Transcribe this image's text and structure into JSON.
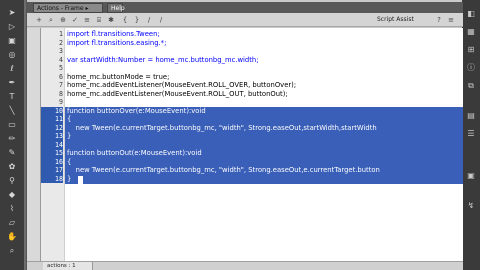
{
  "tabs": {
    "actions_label": "Actions - Frame ▸",
    "help_label": "Help"
  },
  "toolbar": {
    "script_assist_label": "Script Assist",
    "icons": [
      "add-icon",
      "find-icon",
      "target-icon",
      "check-syntax-icon",
      "auto-format-icon",
      "code-hint-icon",
      "debug-icon",
      "collapse-icon",
      "expand-icon",
      "comment-icon",
      "uncomment-icon",
      "help-icon",
      "menu-icon"
    ]
  },
  "editor": {
    "line_numbers": [
      "1",
      "2",
      "3",
      "4",
      "5",
      "6",
      "7",
      "8",
      "9",
      "10",
      "11",
      "12",
      "13",
      "14",
      "15",
      "16",
      "17",
      "18"
    ],
    "selected_lines": [
      10,
      11,
      12,
      13,
      14,
      15,
      16,
      17,
      18
    ],
    "lines": [
      "import fl.transitions.Tween;",
      "import fl.transitions.easing.*;",
      "",
      "var startWidth:Number = home_mc.buttonbg_mc.width;",
      "",
      "home_mc.buttonMode = true;",
      "home_mc.addEventListener(MouseEvent.ROLL_OVER, buttonOver);",
      "home_mc.addEventListener(MouseEvent.ROLL_OUT, buttonOut);",
      "",
      "function buttonOver(e:MouseEvent):void",
      "{",
      "    new Tween(e.currentTarget.buttonbg_mc, \"width\", Strong.easeOut,startWidth,startWidth",
      "}",
      "",
      "function buttonOut(e:MouseEvent):void",
      "{",
      "    new Tween(e.currentTarget.buttonbg_mc, \"width\", Strong.easeOut,e.currentTarget.button",
      "}"
    ]
  },
  "statusbar": {
    "tab_label": "actions : 1",
    "status_text": ""
  },
  "colors": {
    "selection": "#3a5fb8",
    "keyword": "#0000ff",
    "panel": "#c9c9c9"
  }
}
